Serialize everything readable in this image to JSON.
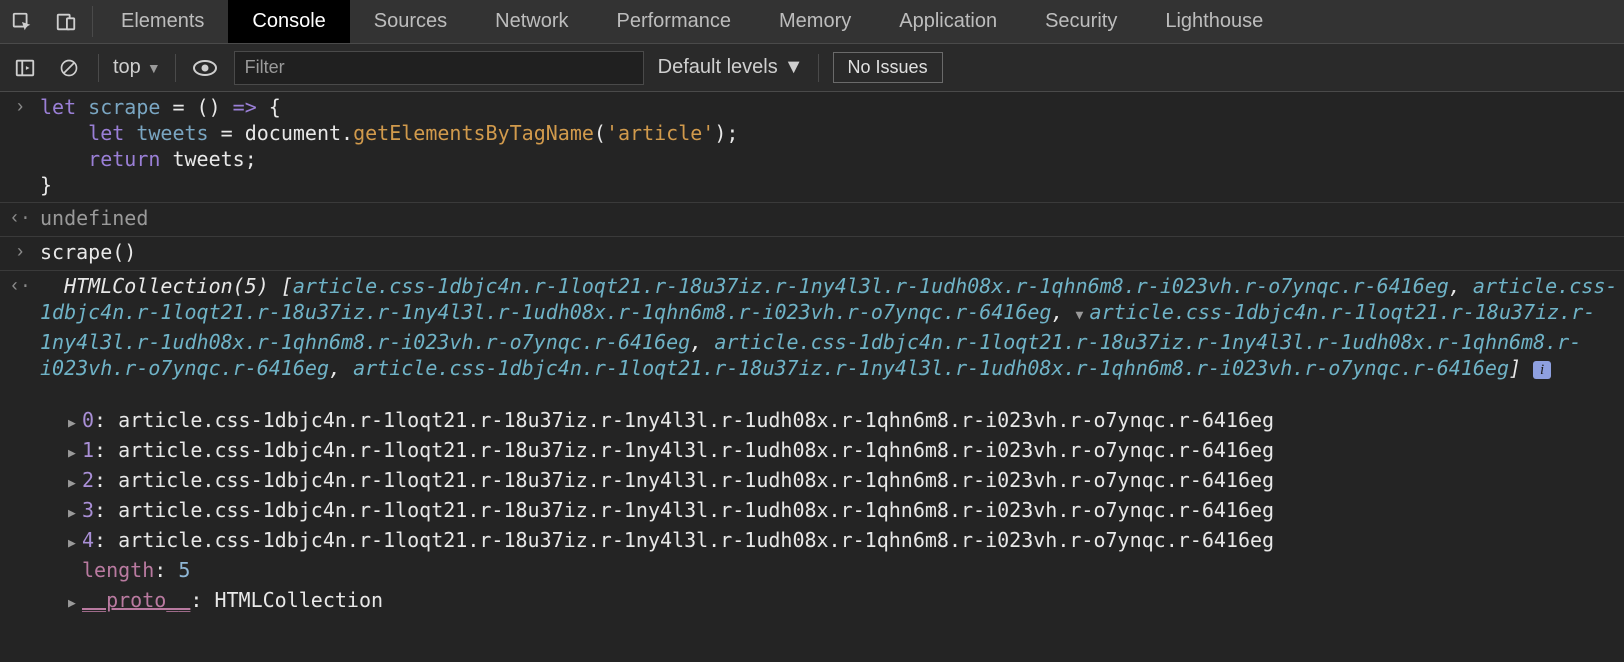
{
  "tabs": [
    "Elements",
    "Console",
    "Sources",
    "Network",
    "Performance",
    "Memory",
    "Application",
    "Security",
    "Lighthouse"
  ],
  "activeTab": "Console",
  "toolbar": {
    "context": "top",
    "filter_placeholder": "Filter",
    "levels": "Default levels",
    "no_issues": "No Issues"
  },
  "code": {
    "l1_let": "let",
    "l1_name": "scrape",
    "l1_eq": " = () ",
    "l1_arrow": "=>",
    "l1_brace": " {",
    "l2_indent": "    ",
    "l2_let": "let",
    "l2_name": " tweets ",
    "l2_eq": "= ",
    "l2_doc": "document",
    "l2_dot": ".",
    "l2_fn": "getElementsByTagName",
    "l2_paren_open": "(",
    "l2_str": "'article'",
    "l2_paren_close": ");",
    "l3_indent": "    ",
    "l3_ret": "return",
    "l3_tw": " tweets",
    "l3_semi": ";",
    "l4_brace": "}"
  },
  "result_undefined": "undefined",
  "call_line": "scrape()",
  "collection": {
    "header_name": "HTMLCollection",
    "header_count": "(5)",
    "bracket_open": "  [",
    "article_class": "article.css-1dbjc4n.r-1loqt21.r-18u37iz.r-1ny4l3l.r-1udh08x.r-1qhn6m8.r-i023vh.r-o7ynqc.r-6416eg",
    "bracket_close": "]",
    "entries": [
      {
        "idx": "0",
        "val": "article.css-1dbjc4n.r-1loqt21.r-18u37iz.r-1ny4l3l.r-1udh08x.r-1qhn6m8.r-i023vh.r-o7ynqc.r-6416eg"
      },
      {
        "idx": "1",
        "val": "article.css-1dbjc4n.r-1loqt21.r-18u37iz.r-1ny4l3l.r-1udh08x.r-1qhn6m8.r-i023vh.r-o7ynqc.r-6416eg"
      },
      {
        "idx": "2",
        "val": "article.css-1dbjc4n.r-1loqt21.r-18u37iz.r-1ny4l3l.r-1udh08x.r-1qhn6m8.r-i023vh.r-o7ynqc.r-6416eg"
      },
      {
        "idx": "3",
        "val": "article.css-1dbjc4n.r-1loqt21.r-18u37iz.r-1ny4l3l.r-1udh08x.r-1qhn6m8.r-i023vh.r-o7ynqc.r-6416eg"
      },
      {
        "idx": "4",
        "val": "article.css-1dbjc4n.r-1loqt21.r-18u37iz.r-1ny4l3l.r-1udh08x.r-1qhn6m8.r-i023vh.r-o7ynqc.r-6416eg"
      }
    ],
    "length_key": "length",
    "length_val": "5",
    "proto_key": "__proto__",
    "proto_val": "HTMLCollection"
  }
}
